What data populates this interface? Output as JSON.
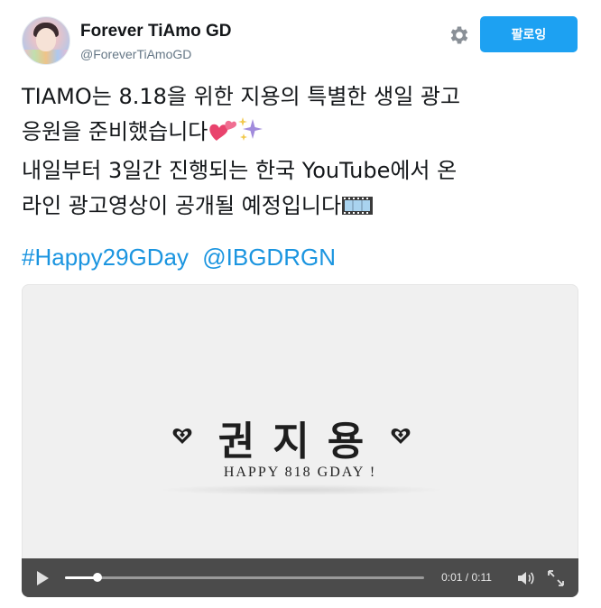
{
  "user": {
    "display_name": "Forever TiAmo GD",
    "handle": "@ForeverTiAmoGD"
  },
  "follow_button": {
    "label": "팔로잉"
  },
  "settings": {
    "icon": "gear-icon"
  },
  "tweet": {
    "line1": "TIAMO는 8.18을 위한 지용의 특별한 생일 광고",
    "line2": "응원을 준비했습니다",
    "line3": "내일부터 3일간 진행되는 한국 YouTube에서  온",
    "line4": "라인 광고영상이 공개될 예정입니다",
    "emojis": [
      "two-hearts-emoji",
      "sparkles-emoji",
      "film-strip-emoji"
    ],
    "hashtag": "#Happy29GDay",
    "mention": "@IBGDRGN"
  },
  "video": {
    "title_chars": [
      "권",
      "지",
      "용"
    ],
    "subtitle": "HAPPY  818  GDAY !",
    "current_time": "0:01",
    "separator": "/",
    "duration": "0:11",
    "progress": 0.09,
    "colors": {
      "controls_bg": "#4b4b4b",
      "accent": "#1da1f2",
      "link": "#1b95e0"
    }
  }
}
